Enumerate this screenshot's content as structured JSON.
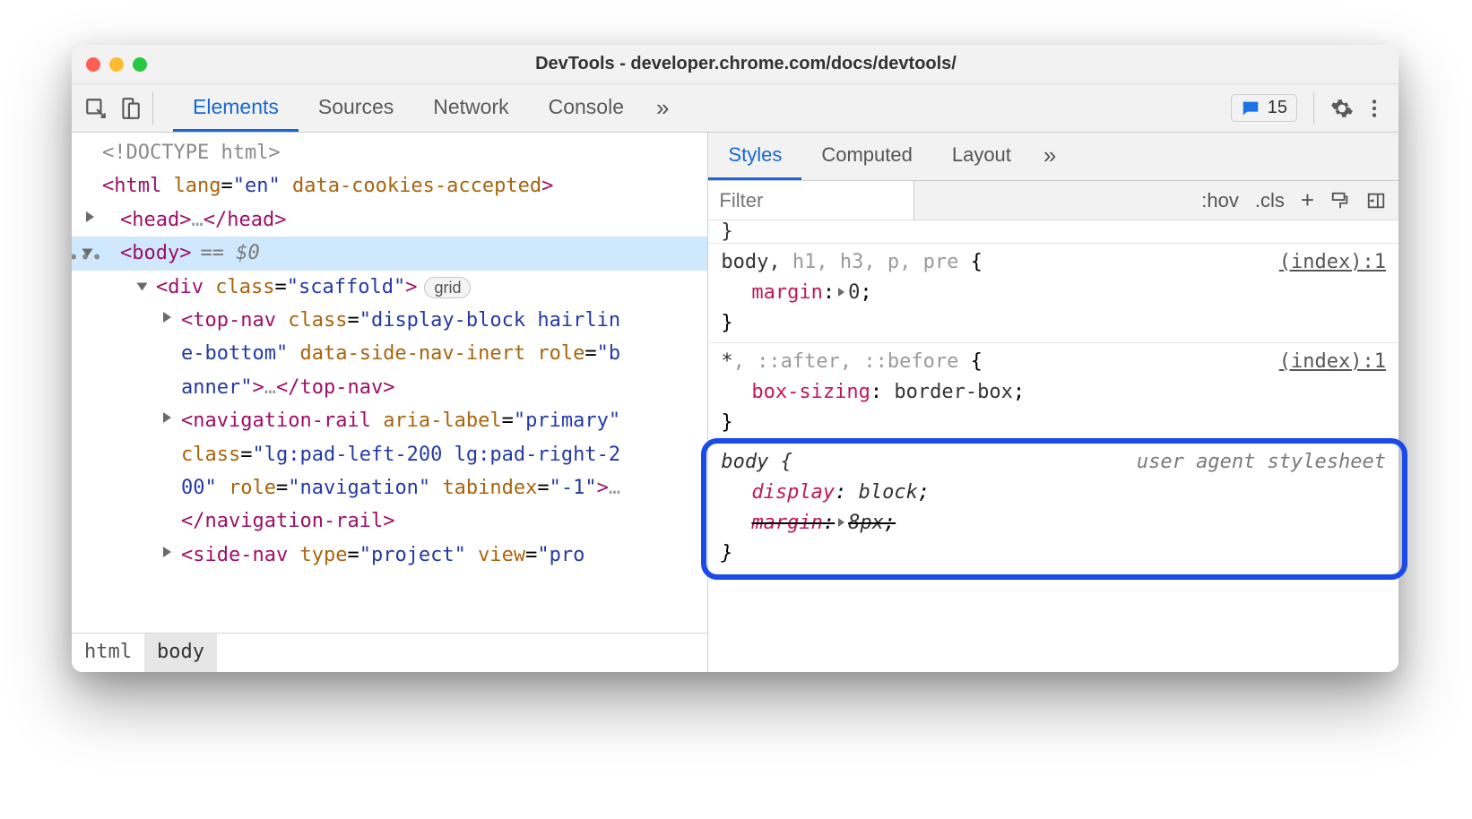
{
  "window": {
    "title": "DevTools - developer.chrome.com/docs/devtools/"
  },
  "toolbar": {
    "tabs": [
      "Elements",
      "Sources",
      "Network",
      "Console"
    ],
    "activeTab": "Elements",
    "issues": {
      "count": "15"
    }
  },
  "dom": {
    "doctype": "<!DOCTYPE html>",
    "html_open": "<html lang=\"en\" data-cookies-accepted>",
    "head_line": "<head>…</head>",
    "body_line": "<body>",
    "eq0": "== $0",
    "div_line": "<div class=\"scaffold\">",
    "grid_badge": "grid",
    "topnav_l1": "<top-nav class=\"display-block hairlin",
    "topnav_l2": "e-bottom\" data-side-nav-inert role=\"b",
    "topnav_l3": "anner\">…</top-nav>",
    "navrail_l1": "<navigation-rail aria-label=\"primary\"",
    "navrail_l2": "class=\"lg:pad-left-200 lg:pad-right-2",
    "navrail_l3": "00\" role=\"navigation\" tabindex=\"-1\">…",
    "navrail_l4": "</navigation-rail>",
    "sidenav_l1": "<side-nav type=\"project\" view=\"pro"
  },
  "crumbs": [
    "html",
    "body"
  ],
  "stylesPanel": {
    "subTabs": [
      "Styles",
      "Computed",
      "Layout"
    ],
    "activeSub": "Styles",
    "filterPlaceholder": "Filter",
    "actions": {
      "hov": ":hov",
      "cls": ".cls"
    },
    "rules": [
      {
        "selector": "body, h1, h3, p, pre {",
        "selectorDark": "body,",
        "selectorDim": " h1, h3, p, pre ",
        "src": "(index):1",
        "props": [
          {
            "name": "margin",
            "value": "0",
            "expand": true
          }
        ]
      },
      {
        "selector": "*, ::after, ::before {",
        "selectorDark": "*",
        "selectorDim": ", ::after, ::before ",
        "src": "(index):1",
        "props": [
          {
            "name": "box-sizing",
            "value": "border-box"
          }
        ]
      },
      {
        "ua": true,
        "selector": "body {",
        "src": "user agent stylesheet",
        "props": [
          {
            "name": "display",
            "value": "block"
          },
          {
            "name": "margin",
            "value": "8px",
            "strike": true,
            "expand": true
          }
        ]
      }
    ]
  }
}
